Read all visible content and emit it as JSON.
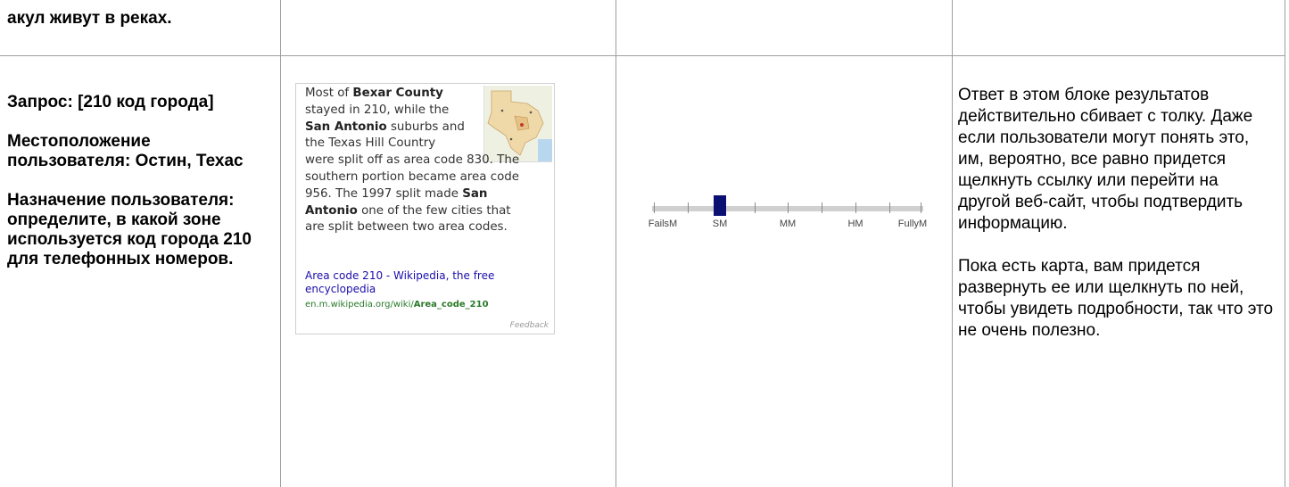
{
  "top_row": {
    "col1_text": "акул живут в реках."
  },
  "row": {
    "query": "Запрос: [210 код города]",
    "location": "Местоположение пользователя: Остин, Техас",
    "intent": "Назначение пользователя: определите, в какой зоне используется код города 210 для телефонных номеров."
  },
  "snippet": {
    "lines": [
      {
        "parts": [
          {
            "t": "Most of "
          },
          {
            "t": "Bexar County",
            "b": true
          }
        ]
      },
      {
        "parts": [
          {
            "t": "stayed in 210, while the"
          }
        ]
      },
      {
        "parts": [
          {
            "t": "San Antonio",
            "b": true
          },
          {
            "t": " suburbs and"
          }
        ]
      },
      {
        "parts": [
          {
            "t": "the Texas Hill Country"
          }
        ]
      },
      {
        "parts": [
          {
            "t": "were split off as area code 830. The"
          }
        ]
      },
      {
        "parts": [
          {
            "t": "southern portion became area code"
          }
        ]
      },
      {
        "parts": [
          {
            "t": "956. The 1997 split made "
          },
          {
            "t": "San",
            "b": true
          }
        ]
      },
      {
        "parts": [
          {
            "t": "Antonio",
            "b": true
          },
          {
            "t": " one of the few cities that"
          }
        ]
      },
      {
        "parts": [
          {
            "t": "are split between two area codes."
          }
        ]
      }
    ],
    "link_text": "Area code 210 - Wikipedia, the free encyclopedia",
    "url_prefix": "en.m.wikipedia.org/wiki/",
    "url_bold": "Area_code_210",
    "feedback": "Feedback"
  },
  "rating": {
    "labels": [
      "FailsM",
      "SM",
      "MM",
      "HM",
      "FullyM"
    ],
    "selected_index": 1
  },
  "comment": {
    "p1": "Ответ в этом блоке результатов действительно сбивает с толку. Даже если пользователи могут понять это, им, вероятно, все равно придется щелкнуть ссылку или перейти на другой веб-сайт, чтобы подтвердить информацию.",
    "p2": "Пока есть карта, вам придется развернуть ее или щелкнуть по ней, чтобы увидеть подробности, так что это не очень полезно."
  }
}
